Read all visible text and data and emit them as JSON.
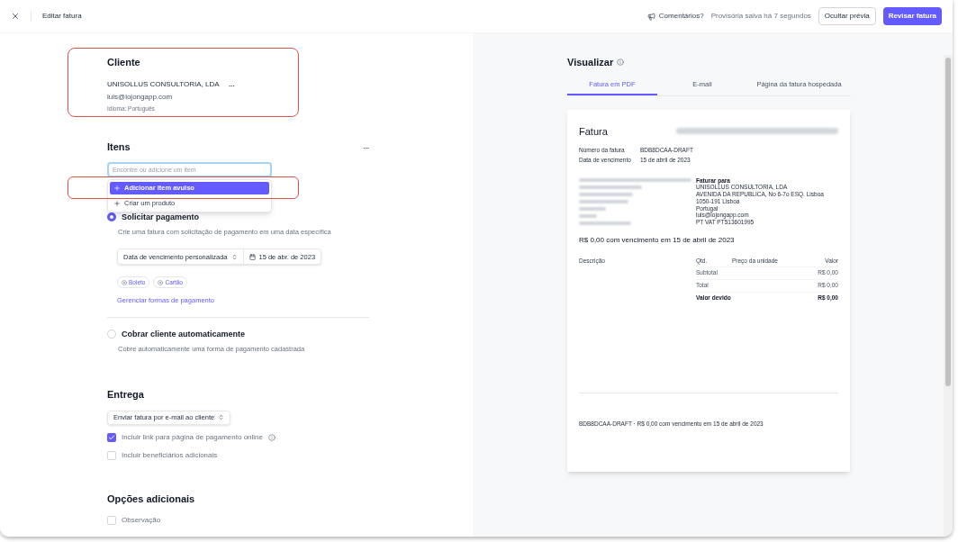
{
  "topbar": {
    "title": "Editar fatura",
    "feedback": "Comentários?",
    "save_status": "Provisória salva há 7 segundos",
    "hide_preview": "Ocultar prévia",
    "review": "Revisar fatura"
  },
  "client": {
    "heading": "Cliente",
    "name": "UNISOLLUS CONSULTORIA, LDA",
    "menu": "...",
    "email": "luis@lojongapp.com",
    "language": "Idioma: Português"
  },
  "items": {
    "heading": "Itens",
    "menu": "...",
    "search": {
      "placeholder": "Encontre ou adicione um item"
    },
    "menu_options": [
      {
        "label": "Adicionar item avulso",
        "selected": true
      },
      {
        "label": "Criar um produto",
        "selected": false
      }
    ]
  },
  "payment": {
    "options": [
      {
        "label": "Solicitar pagamento",
        "description": "Crie uma fatura com solicitação de pagamento em uma data específica",
        "selected": true,
        "due_select": "Data de vencimento personalizada",
        "due_date": "15 de abr. de 2023",
        "methods": [
          "Boleto",
          "Cartão"
        ],
        "manage_link": "Gerenciar formas de pagamento"
      },
      {
        "label": "Cobrar cliente automaticamente",
        "description": "Cobre automaticamente uma forma de pagamento cadastrada",
        "selected": false
      }
    ]
  },
  "delivery": {
    "heading": "Entrega",
    "method": "Enviar fatura por e-mail ao cliente",
    "checkboxes": [
      {
        "label": "Incluir link para página de pagamento online",
        "checked": true,
        "info": true
      },
      {
        "label": "Incluir beneficiários adicionais",
        "checked": false,
        "info": false
      }
    ]
  },
  "additional": {
    "heading": "Opções adicionais",
    "checkboxes": [
      {
        "label": "Observação",
        "checked": false,
        "info": false
      }
    ]
  },
  "preview": {
    "heading": "Visualizar",
    "tabs": [
      {
        "label": "Fatura em PDF",
        "selected": true
      },
      {
        "label": "E-mail",
        "selected": false
      },
      {
        "label": "Página da fatura hospedada",
        "selected": false
      }
    ],
    "invoice": {
      "title": "Fatura",
      "meta": [
        {
          "label": "Número da fatura",
          "value": "BDB8DCAA-DRAFT"
        },
        {
          "label": "Data de vencimento",
          "value": "15 de abril de 2023"
        }
      ],
      "bill_to_heading": "Faturar para",
      "bill_to": [
        "UNISOLLUS CONSULTORIA, LDA",
        "AVENIDA DA REPUBLICA, No 6-7o ESQ. Lisboa",
        "1050-191 Lisboa",
        "Portugal",
        "luis@lojongapp.com",
        "PT VAT PT513601995"
      ],
      "amount_heading": "R$ 0,00 com vencimento em 15 de abril de 2023",
      "columns": [
        "Descrição",
        "Qtd.",
        "Preço da unidade",
        "Valor"
      ],
      "totals": [
        {
          "label": "Subtotal",
          "value": "R$ 0,00",
          "bold": false
        },
        {
          "label": "Total",
          "value": "R$ 0,00",
          "bold": false
        },
        {
          "label": "Valor devido",
          "value": "R$ 0,00",
          "bold": true
        }
      ],
      "footer": "BDB8DCAA-DRAFT · R$ 0,00 com vencimento em 15 de abril de 2023"
    }
  }
}
